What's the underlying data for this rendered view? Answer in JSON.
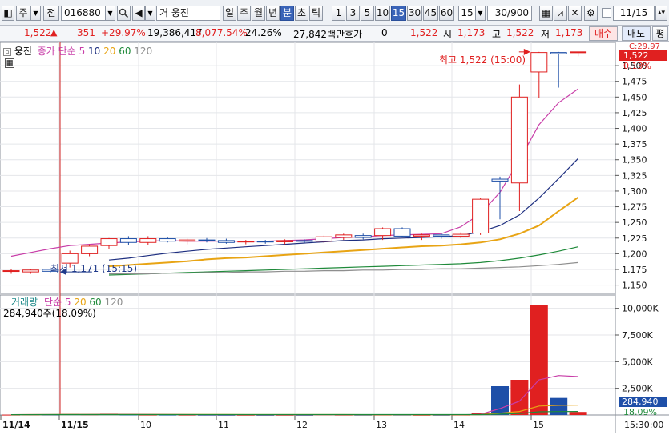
{
  "toolbar": {
    "market_btn": "주",
    "full_btn": "전",
    "code_value": "016880",
    "group_label": "거",
    "stock_name": "웅진",
    "period_buttons": [
      "일",
      "주",
      "월",
      "년",
      "분",
      "초",
      "틱"
    ],
    "selected_period": "분",
    "interval_buttons": [
      "1",
      "3",
      "5",
      "10",
      "15",
      "30",
      "45",
      "60"
    ],
    "selected_interval": "15",
    "interval_select": "15",
    "count_value": "30/900",
    "date_value": "11/15"
  },
  "quote": {
    "price": "1,522",
    "change": "351",
    "change_rate": "+29.97%",
    "volume": "19,386,417",
    "volume_rate": "8,077.54%",
    "turnover": "24.26%",
    "amount": "27,842백만",
    "hoga_label": "호가",
    "hoga_value": "0",
    "price2": "1,522",
    "open_label": "시",
    "open_value": "1,173",
    "high_label": "고",
    "high_value": "1,522",
    "low_label": "저",
    "low_value": "1,173",
    "buy_button": "매수",
    "sell_button": "매도",
    "eval_button": "평"
  },
  "price_panel": {
    "stock_name": "웅진",
    "ma_title": "종가 단순",
    "ma_periods": [
      "5",
      "10",
      "20",
      "60",
      "120"
    ],
    "ma_colors": [
      "#c83ea8",
      "#1e2f80",
      "#e8a414",
      "#1f8a3a",
      "#8e8e8e"
    ],
    "high_annotation": "최고 1,522 (15:00)",
    "low_annotation": "최저 1,171 (15:15)",
    "right_top_label": "C:29.97",
    "price_tag": "1,522",
    "pct_tag": "0.13%"
  },
  "volume_panel": {
    "title": "거래량",
    "ma_title": "단순",
    "ma_periods": [
      "5",
      "20",
      "60",
      "120"
    ],
    "ma_colors": [
      "#c83ea8",
      "#e8a414",
      "#1f8a3a",
      "#8e8e8e"
    ],
    "summary": "284,940주(18.09%)",
    "tag_value": "284,940",
    "tag_pct": "18.09%"
  },
  "time_axis": {
    "labels": [
      "11/14",
      "11/15",
      "10",
      "11",
      "12",
      "13",
      "14",
      "15"
    ],
    "end_time": "15:30:00"
  },
  "chart_data": {
    "type": "candlestick",
    "price_axis": {
      "ticks": [
        1150,
        1175,
        1200,
        1225,
        1250,
        1275,
        1300,
        1325,
        1350,
        1375,
        1400,
        1425,
        1450,
        1475,
        1500
      ],
      "range": [
        1138,
        1532
      ]
    },
    "volume_axis": {
      "ticks": [
        "2,500K",
        "5,000K",
        "7,500K",
        "10,000K"
      ],
      "tick_values": [
        2500,
        5000,
        7500,
        10000
      ],
      "range": [
        0,
        10500
      ],
      "unit": "K"
    },
    "candles": [
      {
        "o": 1172,
        "h": 1175,
        "l": 1168,
        "c": 1173,
        "v": 30
      },
      {
        "o": 1171,
        "h": 1176,
        "l": 1168,
        "c": 1174,
        "v": 40
      },
      {
        "o": 1175,
        "h": 1178,
        "l": 1170,
        "c": 1172,
        "v": 35
      },
      {
        "o": 1185,
        "h": 1205,
        "l": 1178,
        "c": 1200,
        "v": 90
      },
      {
        "o": 1200,
        "h": 1215,
        "l": 1196,
        "c": 1212,
        "v": 60
      },
      {
        "o": 1213,
        "h": 1225,
        "l": 1207,
        "c": 1224,
        "v": 120
      },
      {
        "o": 1224,
        "h": 1228,
        "l": 1214,
        "c": 1218,
        "v": 40
      },
      {
        "o": 1218,
        "h": 1228,
        "l": 1214,
        "c": 1224,
        "v": 30
      },
      {
        "o": 1224,
        "h": 1226,
        "l": 1218,
        "c": 1220,
        "v": 30
      },
      {
        "o": 1220,
        "h": 1224,
        "l": 1215,
        "c": 1222,
        "v": 25
      },
      {
        "o": 1222,
        "h": 1225,
        "l": 1218,
        "c": 1221,
        "v": 20
      },
      {
        "o": 1221,
        "h": 1224,
        "l": 1216,
        "c": 1218,
        "v": 15
      },
      {
        "o": 1219,
        "h": 1222,
        "l": 1215,
        "c": 1220,
        "v": 15
      },
      {
        "o": 1220,
        "h": 1222,
        "l": 1216,
        "c": 1219,
        "v": 10
      },
      {
        "o": 1219,
        "h": 1223,
        "l": 1215,
        "c": 1221,
        "v": 15
      },
      {
        "o": 1221,
        "h": 1223,
        "l": 1217,
        "c": 1220,
        "v": 12
      },
      {
        "o": 1220,
        "h": 1229,
        "l": 1217,
        "c": 1227,
        "v": 40
      },
      {
        "o": 1226,
        "h": 1232,
        "l": 1222,
        "c": 1230,
        "v": 25
      },
      {
        "o": 1229,
        "h": 1232,
        "l": 1223,
        "c": 1226,
        "v": 20
      },
      {
        "o": 1229,
        "h": 1242,
        "l": 1222,
        "c": 1240,
        "v": 30
      },
      {
        "o": 1240,
        "h": 1242,
        "l": 1226,
        "c": 1228,
        "v": 25
      },
      {
        "o": 1228,
        "h": 1232,
        "l": 1222,
        "c": 1230,
        "v": 15
      },
      {
        "o": 1230,
        "h": 1233,
        "l": 1224,
        "c": 1228,
        "v": 15
      },
      {
        "o": 1228,
        "h": 1234,
        "l": 1225,
        "c": 1231,
        "v": 30
      },
      {
        "o": 1233,
        "h": 1289,
        "l": 1230,
        "c": 1287,
        "v": 200
      },
      {
        "o": 1319,
        "h": 1323,
        "l": 1255,
        "c": 1316,
        "v": 2700
      },
      {
        "o": 1313,
        "h": 1470,
        "l": 1268,
        "c": 1450,
        "v": 3300
      },
      {
        "o": 1490,
        "h": 1522,
        "l": 1448,
        "c": 1521,
        "v": 10300
      },
      {
        "o": 1521,
        "h": 1522,
        "l": 1465,
        "c": 1519,
        "v": 1600
      },
      {
        "o": 1521,
        "h": 1522,
        "l": 1515,
        "c": 1522,
        "v": 285
      }
    ],
    "ma_series": [
      {
        "name": "5",
        "start": 4,
        "values": [
          1196,
          1202,
          1208,
          1213,
          1215,
          1217,
          1219,
          1220,
          1221,
          1220,
          1220,
          1220,
          1220,
          1220,
          1221,
          1222,
          1224,
          1226,
          1227,
          1229,
          1230,
          1231,
          1232,
          1243,
          1264,
          1298,
          1350,
          1406,
          1441,
          1463
        ]
      },
      {
        "name": "10",
        "start": 9,
        "values": [
          1190,
          1193,
          1197,
          1201,
          1204,
          1207,
          1209,
          1211,
          1213,
          1215,
          1217,
          1219,
          1221,
          1222,
          1224,
          1225,
          1226,
          1227,
          1229,
          1235,
          1245,
          1262,
          1289,
          1320,
          1352
        ]
      },
      {
        "name": "20",
        "start": 19,
        "values": [
          1180,
          1182,
          1184,
          1186,
          1188,
          1191,
          1193,
          1194,
          1196,
          1198,
          1200,
          1202,
          1204,
          1206,
          1208,
          1210,
          1212,
          1213,
          1215,
          1218,
          1223,
          1232,
          1245,
          1268,
          1290
        ]
      },
      {
        "name": "60",
        "start": 59,
        "values": [
          1166,
          1167,
          1168,
          1169,
          1170,
          1171,
          1172,
          1173,
          1174,
          1175,
          1176,
          1177,
          1178,
          1179,
          1180,
          1181,
          1182,
          1183,
          1184,
          1186,
          1189,
          1193,
          1198,
          1204,
          1211
        ]
      },
      {
        "name": "120",
        "start": 119,
        "values": [
          1168,
          1168,
          1168,
          1169,
          1169,
          1170,
          1170,
          1171,
          1171,
          1172,
          1172,
          1173,
          1173,
          1174,
          1174,
          1175,
          1175,
          1176,
          1176,
          1177,
          1178,
          1179,
          1181,
          1183,
          1186
        ]
      }
    ],
    "volume_ma_series": [
      {
        "name": "5",
        "values": [
          30,
          35,
          35,
          50,
          60,
          70,
          70,
          60,
          50,
          40,
          30,
          25,
          20,
          18,
          16,
          15,
          20,
          25,
          25,
          30,
          30,
          30,
          25,
          25,
          60,
          600,
          1300,
          3300,
          3700,
          3600
        ]
      },
      {
        "name": "20",
        "values": [
          30,
          35,
          38,
          45,
          50,
          55,
          55,
          50,
          48,
          46,
          44,
          42,
          40,
          38,
          36,
          35,
          35,
          34,
          33,
          33,
          32,
          31,
          30,
          30,
          38,
          170,
          330,
          840,
          910,
          920
        ]
      },
      {
        "name": "60",
        "values": [
          30,
          32,
          34,
          36,
          38,
          40,
          40,
          40,
          40,
          40,
          40,
          40,
          40,
          39,
          39,
          38,
          38,
          37,
          37,
          37,
          36,
          36,
          36,
          36,
          38,
          80,
          140,
          300,
          320,
          330
        ]
      }
    ]
  }
}
